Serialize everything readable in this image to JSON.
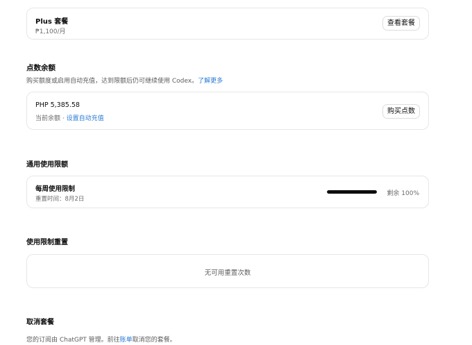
{
  "plan": {
    "name": "Plus 套餐",
    "price": "₱1,100/月",
    "view_button": "查看套餐"
  },
  "credits": {
    "heading": "点数余额",
    "desc_prefix": "购买额度或启用自动充值，达到限额后仍可继续使用 Codex。",
    "learn_more": "了解更多",
    "balance": "PHP 5,385.58",
    "balance_label": "当前余额 · ",
    "auto_topup_link": "设置自动充值",
    "buy_button": "购买点数"
  },
  "usage": {
    "heading": "通用使用限额",
    "weekly_title": "每周使用限制",
    "reset_time": "重置时间：8月2日",
    "remaining_label": "剩余 100%",
    "remaining_fraction": 1.0
  },
  "reset": {
    "heading": "使用限制重置",
    "empty_text": "无可用重置次数"
  },
  "cancel": {
    "heading": "取消套餐",
    "text_prefix": "您的订阅由 ChatGPT 管理。前往",
    "billing_link": "账单",
    "text_suffix": "取消您的套餐。"
  },
  "colors": {
    "link": "#2b7bd6",
    "bar_fill": "#0d0d0d",
    "border": "#e6e6e6"
  }
}
